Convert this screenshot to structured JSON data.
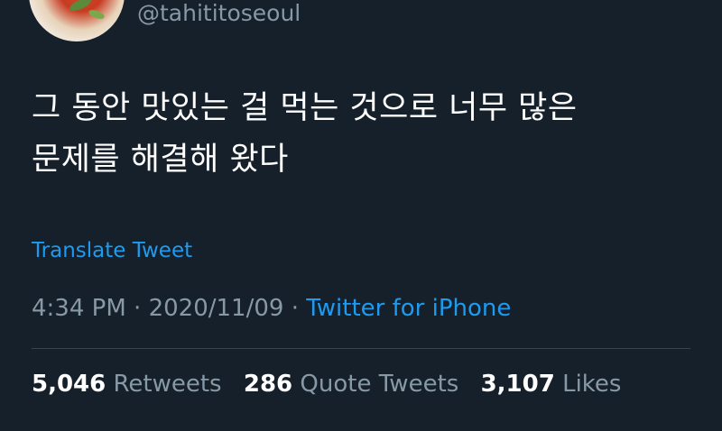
{
  "user": {
    "handle": "@tahititoseoul"
  },
  "tweet": {
    "text_line1": "그 동안 맛있는 걸 먹는 것으로 너무 많은",
    "text_line2": "문제를 해결해 왔다",
    "translate_label": "Translate Tweet",
    "time": "4:34 PM",
    "separator": "·",
    "date": "2020/11/09",
    "source": "Twitter for iPhone"
  },
  "stats": {
    "retweets_count": "5,046",
    "retweets_label": "Retweets",
    "quote_count": "286",
    "quote_label": "Quote Tweets",
    "likes_count": "3,107",
    "likes_label": "Likes"
  },
  "colors": {
    "background": "#15202b",
    "text_primary": "#ffffff",
    "text_secondary": "#8899a6",
    "link": "#1d9bf0",
    "divider": "#38444d"
  }
}
